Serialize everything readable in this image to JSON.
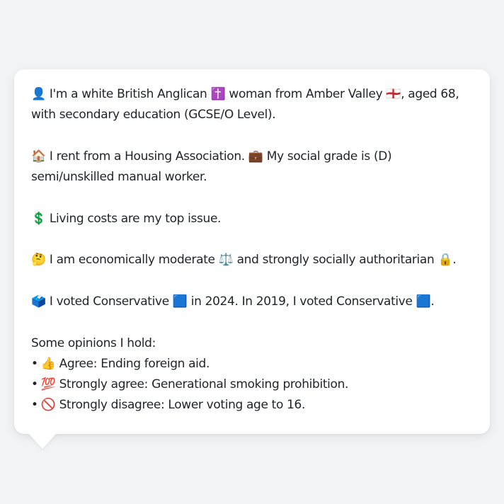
{
  "bubble": {
    "line1": {
      "icon": "👤",
      "text_a": " I'm a white British Anglican ",
      "icon_b": "✝️",
      "text_b": " woman from Amber Valley ",
      "icon_c": "🏴󠁧󠁢󠁥󠁮󠁧󠁿",
      "text_c": ", aged 68, with secondary education (GCSE/O Level)."
    },
    "line2": {
      "icon": "🏠",
      "text_a": " I rent from a Housing Association. ",
      "icon_b": "💼",
      "text_b": " My social grade is (D) semi/unskilled manual worker."
    },
    "line3": {
      "icon": "💲",
      "text_a": " Living costs are my top issue."
    },
    "line4": {
      "icon": "🤔",
      "text_a": " I am economically moderate ",
      "icon_b": "⚖️",
      "text_b": " and strongly socially authoritarian ",
      "icon_c": "🔒",
      "text_c": "."
    },
    "line5": {
      "icon": "🗳️",
      "text_a": " I voted Conservative ",
      "icon_b": "🟦",
      "text_b": " in 2024. In 2019, I voted Conservative ",
      "icon_c": "🟦",
      "text_c": "."
    },
    "opinions_heading": "Some opinions I hold:",
    "opinions": [
      {
        "bullet": "•",
        "icon": "👍",
        "text": " Agree: Ending foreign aid."
      },
      {
        "bullet": "•",
        "icon": "💯",
        "text": " Strongly agree: Generational smoking prohibition."
      },
      {
        "bullet": "•",
        "icon": "🚫",
        "text": " Strongly disagree: Lower voting age to 16."
      }
    ]
  }
}
